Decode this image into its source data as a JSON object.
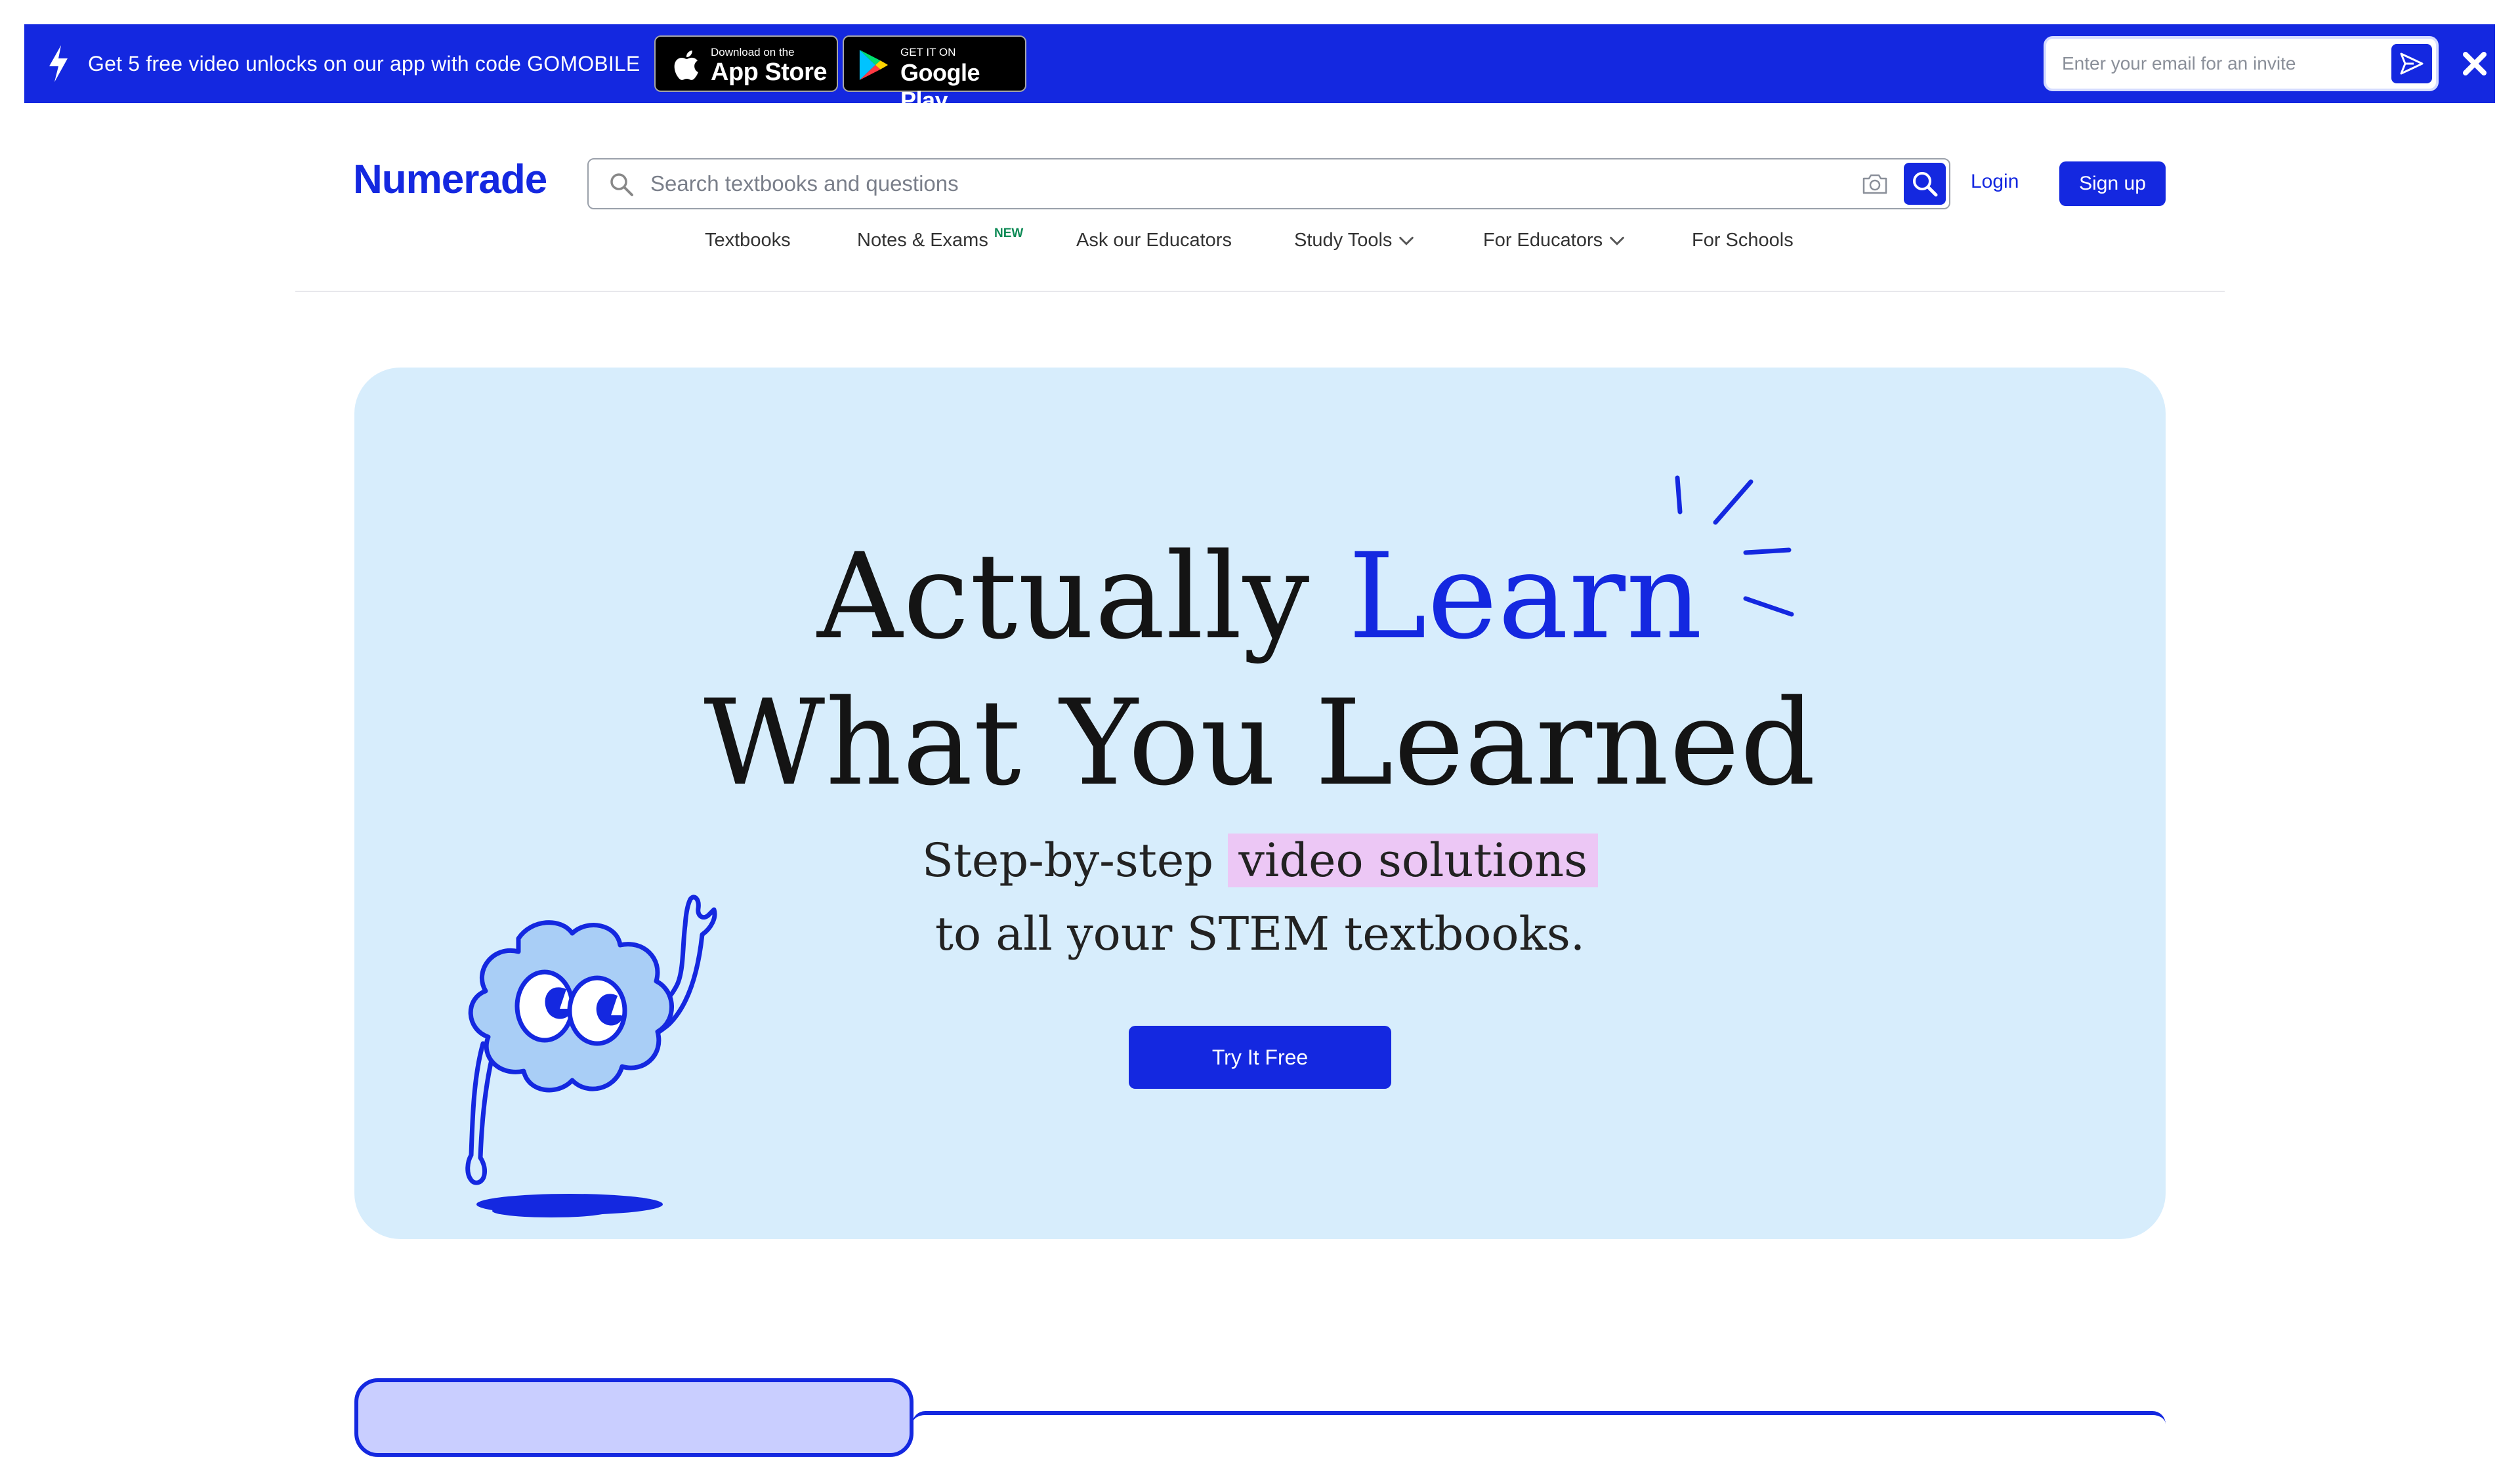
{
  "promo": {
    "text": "Get 5 free video unlocks on our app with code GOMOBILE",
    "app_store": {
      "small": "Download on the",
      "big": "App Store"
    },
    "google_play": {
      "small": "GET IT ON",
      "big": "Google Play"
    },
    "invite_placeholder": "Enter your email for an invite"
  },
  "header": {
    "brand": "Numerade",
    "search_placeholder": "Search textbooks and questions",
    "login": "Login",
    "signup": "Sign up"
  },
  "nav": {
    "textbooks": "Textbooks",
    "notes_exams": "Notes & Exams",
    "new_badge": "NEW",
    "ask_educators": "Ask our Educators",
    "study_tools": "Study Tools",
    "for_educators": "For Educators",
    "for_schools": "For Schools"
  },
  "hero": {
    "line1_a": "Actually ",
    "line1_b": "Learn",
    "line2": "What You Learned",
    "sub1_a": "Step-by-step ",
    "sub1_b": "video solutions",
    "sub2": "to all your STEM textbooks.",
    "cta": "Try It Free"
  },
  "colors": {
    "brand_blue": "#1428e0",
    "hero_bg": "#d7edfc",
    "highlight": "#ecc7f5"
  }
}
